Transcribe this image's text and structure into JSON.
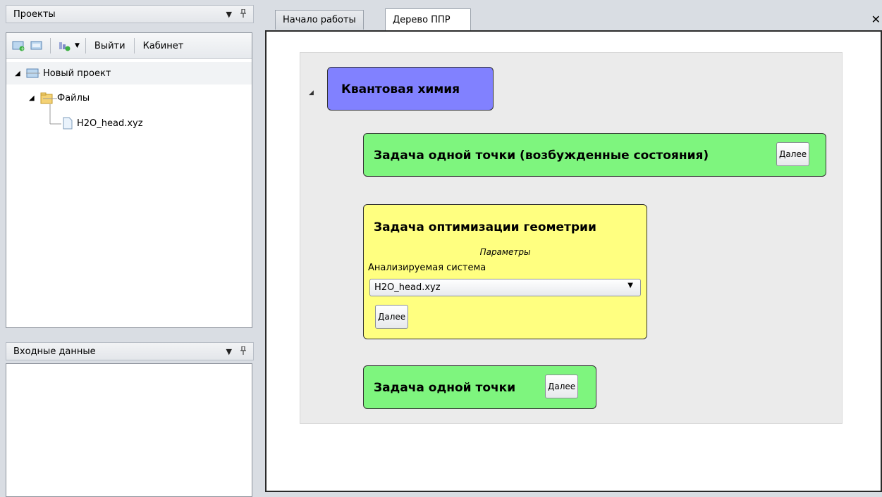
{
  "projects_panel": {
    "title": "Проекты",
    "toolbar": {
      "exit_label": "Выйти",
      "cabinet_label": "Кабинет"
    },
    "tree": {
      "project": "Новый проект",
      "files_folder": "Файлы",
      "file": "H2O_head.xyz"
    }
  },
  "input_panel": {
    "title": "Входные данные"
  },
  "tabs": [
    {
      "label": "Начало работы"
    },
    {
      "label": "Дерево ППР"
    }
  ],
  "tree_view": {
    "root": "Квантовая химия",
    "nodes": {
      "excited": {
        "label": "Задача одной точки (возбужденные состояния)",
        "button": "Далее"
      },
      "geometry": {
        "label": "Задача оптимизации геометрии",
        "params_title": "Параметры",
        "system_label": "Анализируемая система",
        "system_value": "H2O_head.xyz",
        "button": "Далее"
      },
      "single": {
        "label": "Задача одной точки",
        "button": "Далее"
      }
    }
  },
  "colors": {
    "root_node": "#8181ff",
    "green_node": "#7ef57e",
    "yellow_node": "#ffff80"
  }
}
